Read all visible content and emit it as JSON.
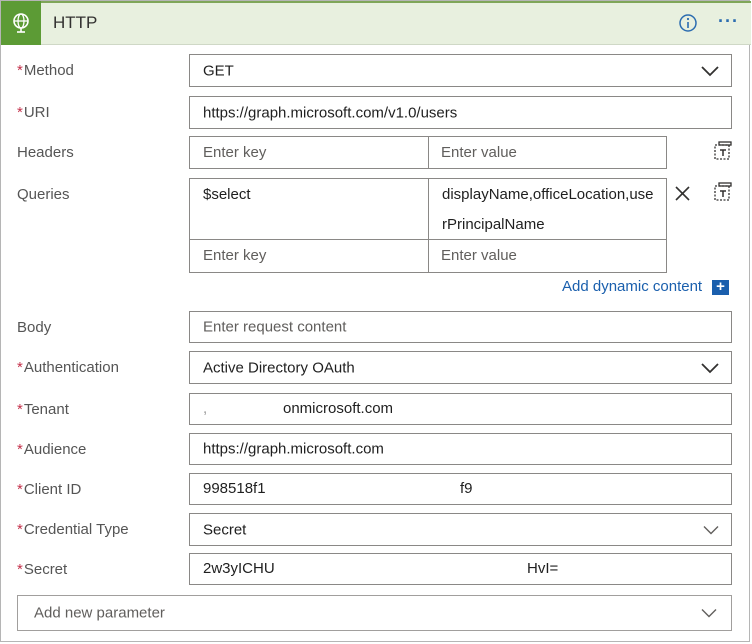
{
  "header": {
    "title": "HTTP"
  },
  "fields": {
    "method": {
      "label": "Method",
      "value": "GET"
    },
    "uri": {
      "label": "URI",
      "value": "https://graph.microsoft.com/v1.0/users"
    },
    "headers": {
      "label": "Headers",
      "key_placeholder": "Enter key",
      "value_placeholder": "Enter value"
    },
    "queries": {
      "label": "Queries",
      "row1_key": "$select",
      "row1_value_line1": "displayName,officeLocation,use",
      "row1_value_line2": "rPrincipalName",
      "key_placeholder": "Enter key",
      "value_placeholder": "Enter value",
      "add_dynamic": "Add dynamic content"
    },
    "body": {
      "label": "Body",
      "placeholder": "Enter request content"
    },
    "authentication": {
      "label": "Authentication",
      "value": "Active Directory OAuth"
    },
    "tenant": {
      "label": "Tenant",
      "value": "onmicrosoft.com"
    },
    "audience": {
      "label": "Audience",
      "value": "https://graph.microsoft.com"
    },
    "client_id": {
      "label": "Client ID",
      "value_start": "998518f1",
      "value_end": "f9"
    },
    "credential_type": {
      "label": "Credential Type",
      "value": "Secret"
    },
    "secret": {
      "label": "Secret",
      "value_start": "2w3yICHU",
      "value_end": "HvI="
    }
  },
  "add_parameter": {
    "placeholder": "Add new parameter"
  },
  "icons": [
    "globe-icon",
    "info-icon",
    "more-icon",
    "chevron-down-icon",
    "copy-table-icon",
    "close-icon",
    "plus-icon"
  ],
  "colors": {
    "header_bg": "#e8f0df",
    "accent": "#5c9b35",
    "link": "#1a5fad",
    "required": "#c4314b"
  }
}
